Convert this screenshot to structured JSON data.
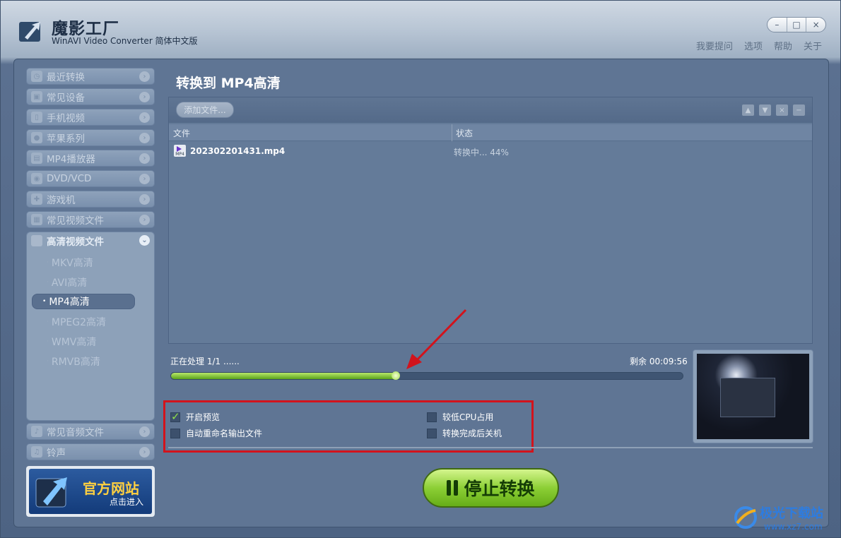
{
  "app": {
    "name": "魔影工厂",
    "subtitle": "WinAVI Video Converter 简体中文版"
  },
  "window_controls": {
    "minimize": "–",
    "maximize": "□",
    "close": "×"
  },
  "top_links": [
    "我要提问",
    "选项",
    "帮助",
    "关于"
  ],
  "sidebar": {
    "categories": [
      {
        "label": "最近转换",
        "icon": "clock-icon"
      },
      {
        "label": "常见设备",
        "icon": "device-icon"
      },
      {
        "label": "手机视频",
        "icon": "phone-icon"
      },
      {
        "label": "苹果系列",
        "icon": "apple-icon"
      },
      {
        "label": "MP4播放器",
        "icon": "player-icon"
      },
      {
        "label": "DVD/VCD",
        "icon": "disc-icon"
      },
      {
        "label": "游戏机",
        "icon": "gamepad-icon"
      },
      {
        "label": "常见视频文件",
        "icon": "video-file-icon"
      }
    ],
    "open_category": {
      "label": "高清视频文件",
      "icon": "hd-icon"
    },
    "sub_items": [
      "MKV高清",
      "AVI高清",
      "MP4高清",
      "MPEG2高清",
      "WMV高清",
      "RMVB高清"
    ],
    "active_sub_item": "MP4高清",
    "bottom_categories": [
      {
        "label": "常见音频文件",
        "icon": "music-icon"
      },
      {
        "label": "铃声",
        "icon": "bell-icon"
      }
    ],
    "promo": {
      "title": "官方网站",
      "subtitle": "点击进入"
    }
  },
  "main": {
    "title": "转换到 MP4高清",
    "add_file_button": "添加文件...",
    "columns": {
      "file": "文件",
      "status": "状态"
    },
    "files": [
      {
        "name": "202302201431.mp4",
        "status": "转换中... 44%",
        "icon_label": "MP4"
      }
    ],
    "processing_label": "正在处理 1/1 ......",
    "remaining": "剩余 00:09:56",
    "progress": 0.44,
    "options": {
      "preview": {
        "label": "开启预览",
        "checked": true
      },
      "low_cpu": {
        "label": "较低CPU占用",
        "checked": false
      },
      "auto_rename": {
        "label": "自动重命名输出文件",
        "checked": false
      },
      "shutdown": {
        "label": "转换完成后关机",
        "checked": false
      }
    },
    "stop_button": "停止转换"
  },
  "watermark": {
    "text": "极光下载站",
    "url": "www.xz7.com"
  },
  "colors": {
    "accent_green": "#8ccf35",
    "annotation_red": "#d2131c",
    "panel_blue": "#5f7594"
  }
}
